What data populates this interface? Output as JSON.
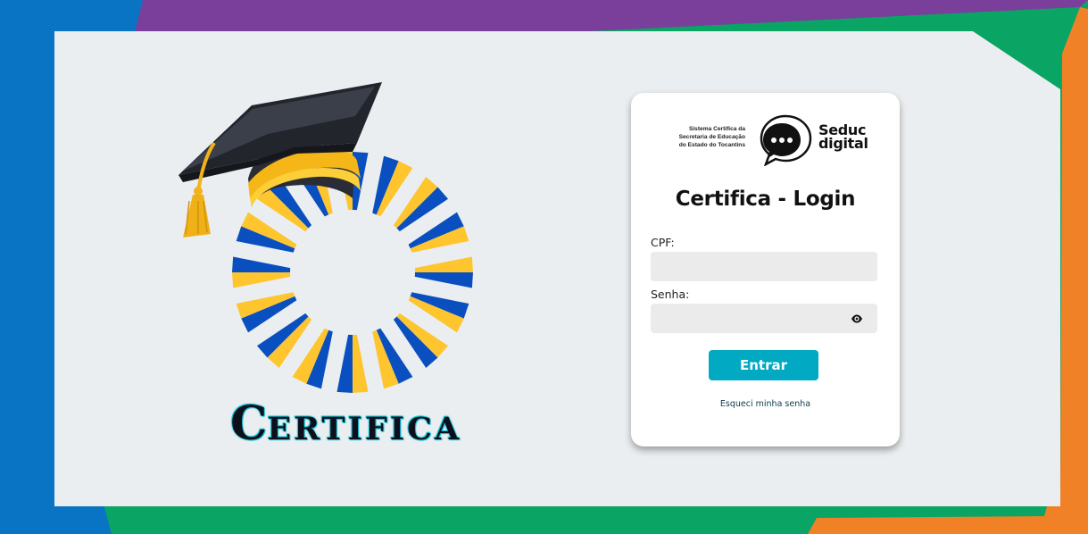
{
  "background": {
    "colors": {
      "blue": "#0a74c4",
      "purple": "#7a3f9b",
      "green": "#0aa465",
      "orange": "#f08126",
      "panel": "#ebeef0"
    }
  },
  "brand": {
    "logo_icon": "graduation-cap-sunburst-icon",
    "first_letter": "C",
    "rest": "ERTIFICA",
    "colors": {
      "yellow": "#fec52e",
      "blue": "#0a4fbf",
      "outline": "#13c6d9"
    }
  },
  "card": {
    "system_text": [
      "Sistema Certifica da",
      "Secretaria de Educação",
      "do Estado do Tocantins"
    ],
    "seduc_logo": {
      "icon": "chat-bubble-icon",
      "line1": "Seduc",
      "line2": "digital"
    },
    "title": "Certifica - Login",
    "cpf": {
      "label": "CPF:",
      "value": "",
      "placeholder": ""
    },
    "senha": {
      "label": "Senha:",
      "value": "",
      "placeholder": ""
    },
    "eye_icon": "eye-icon",
    "submit_label": "Entrar",
    "forgot_label": "Esqueci minha senha",
    "accent": "#01a9c3"
  }
}
